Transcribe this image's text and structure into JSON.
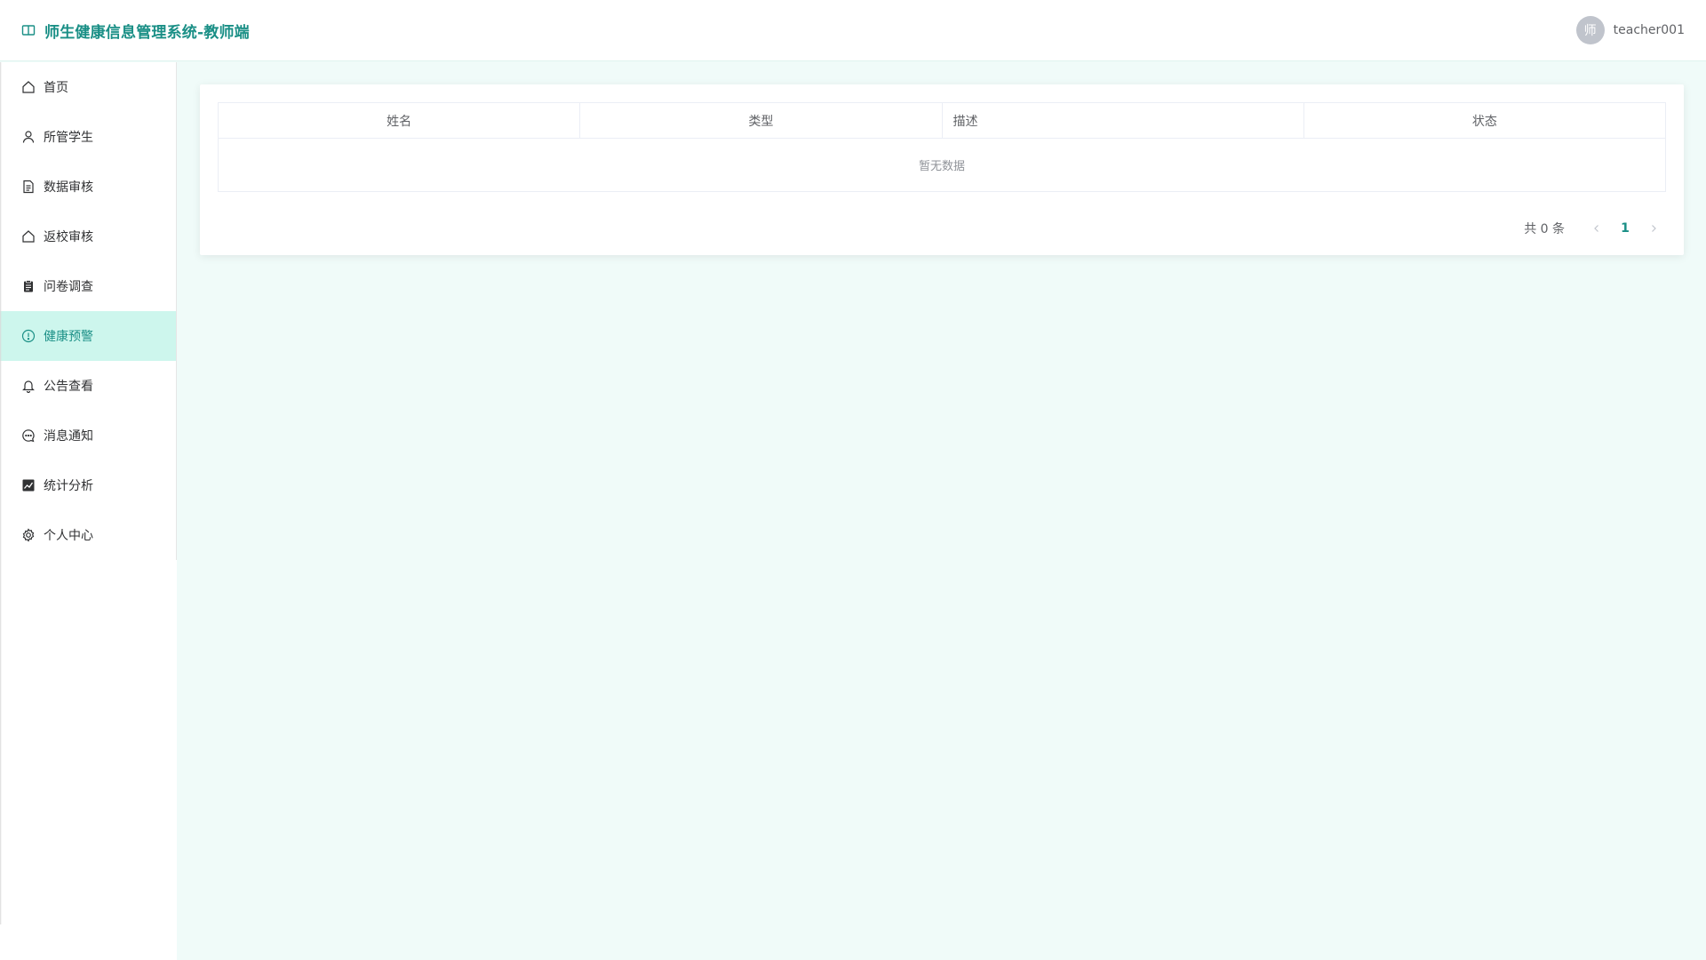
{
  "header": {
    "app_title": "师生健康信息管理系统-教师端",
    "avatar_text": "师",
    "username": "teacher001"
  },
  "colors": {
    "accent": "#1a8f86",
    "active_bg": "#cdf6ed",
    "content_bg": "#f0fbf9"
  },
  "sidebar": {
    "items": [
      {
        "label": "首页",
        "icon": "home-icon",
        "active": false
      },
      {
        "label": "所管学生",
        "icon": "user-icon",
        "active": false
      },
      {
        "label": "数据审核",
        "icon": "document-icon",
        "active": false
      },
      {
        "label": "返校审核",
        "icon": "home-outline-icon",
        "active": false
      },
      {
        "label": "问卷调查",
        "icon": "clipboard-icon",
        "active": false
      },
      {
        "label": "健康预警",
        "icon": "warning-circle-icon",
        "active": true
      },
      {
        "label": "公告查看",
        "icon": "bell-icon",
        "active": false
      },
      {
        "label": "消息通知",
        "icon": "chat-icon",
        "active": false
      },
      {
        "label": "统计分析",
        "icon": "chart-icon",
        "active": false
      },
      {
        "label": "个人中心",
        "icon": "gear-icon",
        "active": false
      }
    ]
  },
  "table": {
    "columns": [
      "姓名",
      "类型",
      "描述",
      "状态"
    ],
    "empty_text": "暂无数据"
  },
  "pagination": {
    "total_text": "共 0 条",
    "current_page": "1",
    "prev_symbol": "‹",
    "next_symbol": "›"
  }
}
